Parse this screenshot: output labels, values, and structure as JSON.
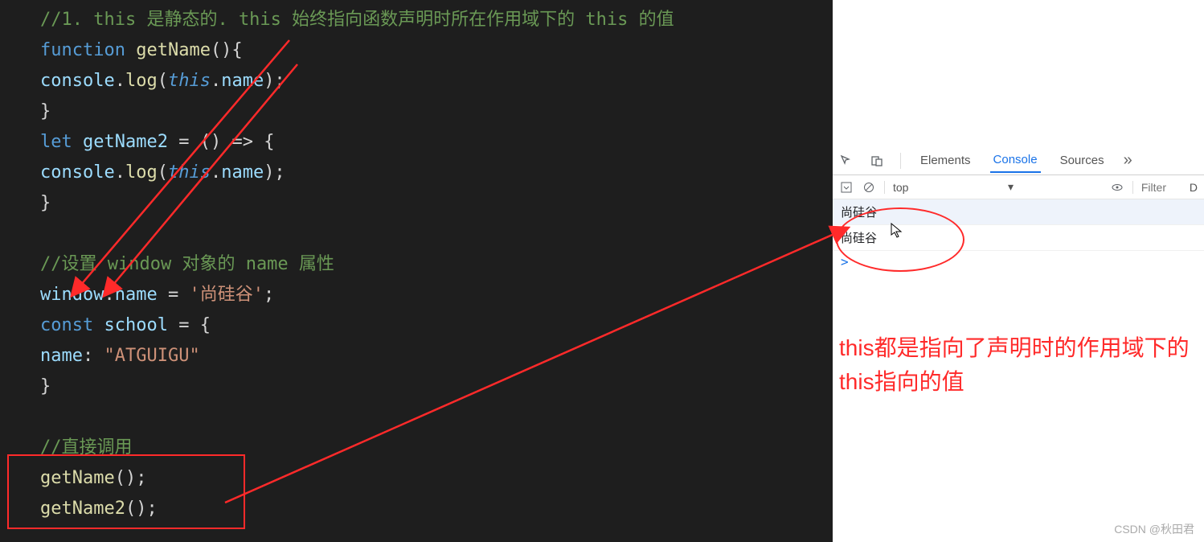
{
  "code": {
    "comment1": "//1. this 是静态的. this 始终指向函数声明时所在作用域下的 this 的值",
    "line2_function": "function",
    "line2_name": "getName",
    "line2_paren": "(){",
    "line3_indent": "    ",
    "line3_console": "console",
    "line3_dot": ".",
    "line3_log": "log",
    "line3_open": "(",
    "line3_this": "this",
    "line3_dot2": ".",
    "line3_name": "name",
    "line3_close": ");",
    "line4": "}",
    "line5_let": "let",
    "line5_name": "getName2",
    "line5_eq": " = ",
    "line5_arrow": "() => {",
    "line6_indent": "    ",
    "line6_console": "console",
    "line6_dot": ".",
    "line6_log": "log",
    "line6_open": "(",
    "line6_this": "this",
    "line6_dot2": ".",
    "line6_name": "name",
    "line6_close": ");",
    "line7": "}",
    "line8": "",
    "comment2": "//设置 window 对象的 name 属性",
    "line10_window": "window",
    "line10_dot": ".",
    "line10_name": "name",
    "line10_eq": " = ",
    "line10_str": "'尚硅谷'",
    "line10_semi": ";",
    "line11_const": "const",
    "line11_school": "school",
    "line11_eq": " = {",
    "line12_indent": "    ",
    "line12_name": "name",
    "line12_colon": ": ",
    "line12_str": "\"ATGUIGU\"",
    "line13": "}",
    "line14": "",
    "comment3": "//直接调用",
    "line16_call": "getName",
    "line16_paren": "();",
    "line17_call": "getName2",
    "line17_paren": "();"
  },
  "devtools": {
    "tabs": {
      "elements": "Elements",
      "console": "Console",
      "sources": "Sources"
    },
    "toolbar": {
      "context": "top",
      "filter_placeholder": "Filter",
      "letter": "D"
    },
    "output": {
      "row1": "尚硅谷",
      "row2": "尚硅谷",
      "prompt": ">"
    }
  },
  "annotation": {
    "text": "this都是指向了声明时的作用域下的this指向的值"
  },
  "watermark": "CSDN @秋田君"
}
